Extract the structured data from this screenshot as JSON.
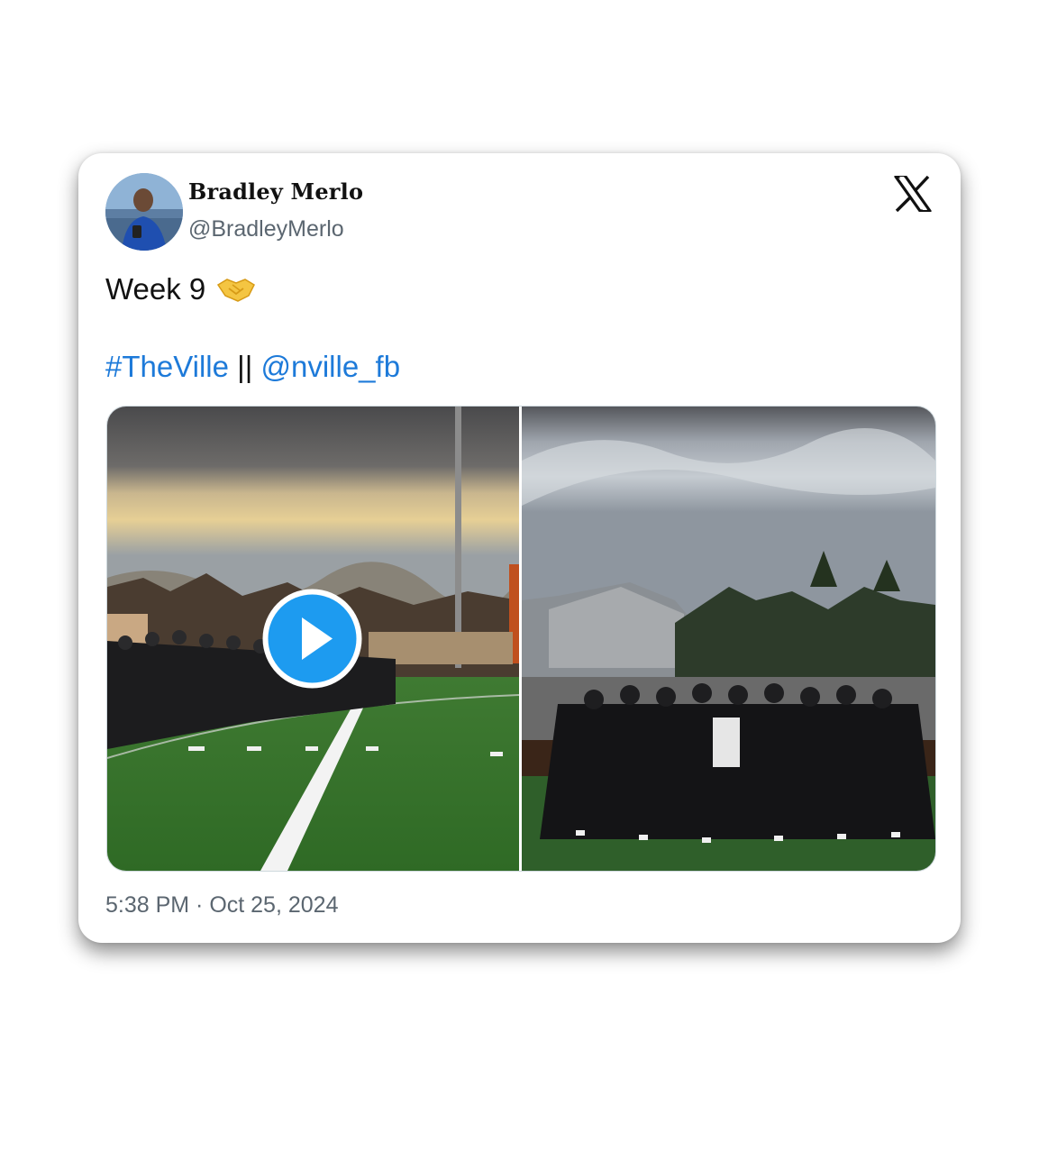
{
  "tweet": {
    "author_name": "Bradley Merlo",
    "author_handle": "@BradleyMerlo",
    "text_line1": "Week 9",
    "emoji": "handshake-emoji",
    "hashtag": "#TheVille",
    "separator": " || ",
    "mention": "@nville_fb",
    "timestamp": "5:38 PM · Oct 25, 2024"
  },
  "icons": {
    "platform": "x-logo-icon",
    "play": "play-icon"
  },
  "colors": {
    "link": "#1d7ad9",
    "play_button": "#1d9bf0",
    "secondary_text": "#5b6670"
  }
}
